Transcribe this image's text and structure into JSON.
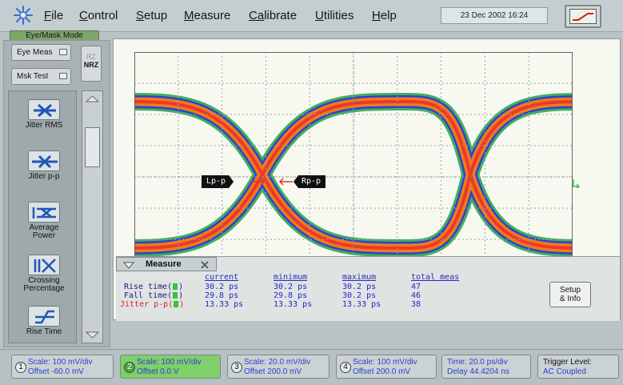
{
  "menu": {
    "items": [
      {
        "label": "File",
        "ul": "F",
        "rest": "ile"
      },
      {
        "label": "Control",
        "ul": "C",
        "rest": "ontrol"
      },
      {
        "label": "Setup",
        "ul": "S",
        "rest": "etup"
      },
      {
        "label": "Measure",
        "ul": "M",
        "rest": "easure"
      },
      {
        "label": "Calibrate",
        "ul": "Ca",
        "rest": "librate"
      },
      {
        "label": "Utilities",
        "ul": "U",
        "rest": "tilities"
      },
      {
        "label": "Help",
        "ul": "H",
        "rest": "elp"
      }
    ],
    "datetime": "23 Dec 2002  16:24"
  },
  "mode": {
    "label": "Eye/Mask Mode",
    "eye_meas": "Eye Meas",
    "msk_test": "Msk Test",
    "rz": "RZ",
    "nrz": "NRZ"
  },
  "tools": [
    {
      "label1": "Jitter RMS",
      "label2": ""
    },
    {
      "label1": "Jitter p-p",
      "label2": ""
    },
    {
      "label1": "Average",
      "label2": "Power"
    },
    {
      "label1": "Crossing",
      "label2": "Percentage"
    },
    {
      "label1": "Rise Time",
      "label2": ""
    }
  ],
  "display": {
    "markers": {
      "left": "Lp-p",
      "right": "Rp-p"
    },
    "colors": {
      "grid": "#9aa2a6",
      "trace_outer": "#2ea84a",
      "trace_mid": "#2b40d8",
      "trace_inner": "#f07a1a",
      "trace_core": "#e83a2a"
    }
  },
  "measure": {
    "tab_label": "Measure",
    "headers": [
      "current",
      "minimum",
      "maximum",
      "total meas"
    ],
    "rows": [
      {
        "label": "Rise time(",
        "current": "30.2 ps",
        "minimum": "30.2 ps",
        "maximum": "30.2 ps",
        "total": "47"
      },
      {
        "label": "Fall time(",
        "current": "29.8 ps",
        "minimum": "29.8 ps",
        "maximum": "30.2 ps",
        "total": "46"
      },
      {
        "label": "Jitter p-p(",
        "current": "13.33 ps",
        "minimum": "13.33 ps",
        "maximum": "13.33 ps",
        "total": "38"
      }
    ],
    "setup_line1": "Setup",
    "setup_line2": "& Info"
  },
  "channels": [
    {
      "num": "1",
      "scale": "Scale: 100 mV/div",
      "offset": "Offset -60.0 mV"
    },
    {
      "num": "2",
      "scale": "Scale: 100 mV/div",
      "offset": "Offset 0.0 V"
    },
    {
      "num": "3",
      "scale": "Scale: 20.0 mV/div",
      "offset": "Offset 200.0 mV"
    },
    {
      "num": "4",
      "scale": "Scale: 100 mV/div",
      "offset": "Offset 200.0 mV"
    }
  ],
  "timebase": {
    "time": "Time: 20.0 ps/div",
    "delay": "Delay 44.4204 ns"
  },
  "trigger": {
    "label": "Trigger Level:",
    "value": "AC Coupled"
  }
}
